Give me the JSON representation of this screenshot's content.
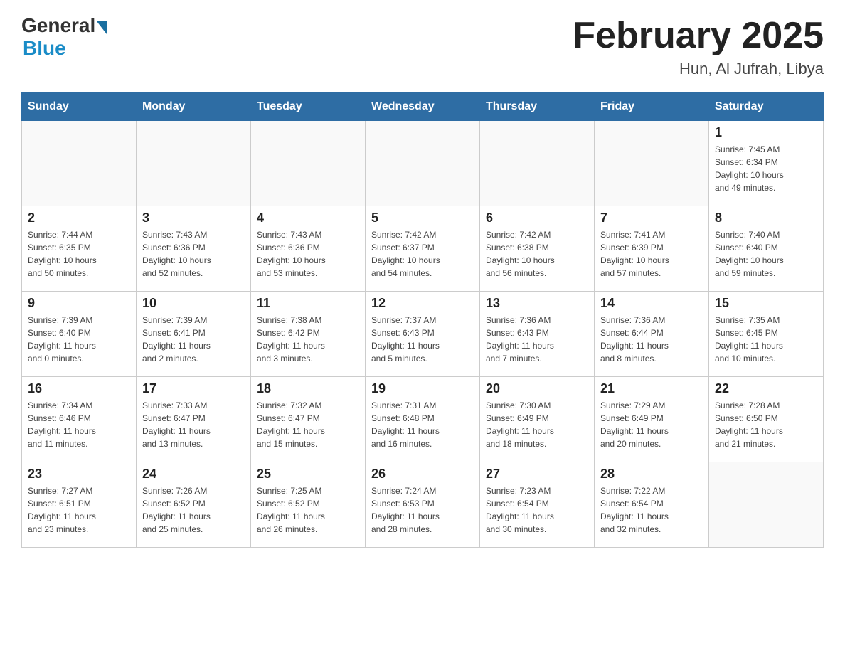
{
  "header": {
    "logo_general": "General",
    "logo_blue": "Blue",
    "title": "February 2025",
    "subtitle": "Hun, Al Jufrah, Libya"
  },
  "weekdays": [
    "Sunday",
    "Monday",
    "Tuesday",
    "Wednesday",
    "Thursday",
    "Friday",
    "Saturday"
  ],
  "weeks": [
    [
      {
        "day": "",
        "info": ""
      },
      {
        "day": "",
        "info": ""
      },
      {
        "day": "",
        "info": ""
      },
      {
        "day": "",
        "info": ""
      },
      {
        "day": "",
        "info": ""
      },
      {
        "day": "",
        "info": ""
      },
      {
        "day": "1",
        "info": "Sunrise: 7:45 AM\nSunset: 6:34 PM\nDaylight: 10 hours\nand 49 minutes."
      }
    ],
    [
      {
        "day": "2",
        "info": "Sunrise: 7:44 AM\nSunset: 6:35 PM\nDaylight: 10 hours\nand 50 minutes."
      },
      {
        "day": "3",
        "info": "Sunrise: 7:43 AM\nSunset: 6:36 PM\nDaylight: 10 hours\nand 52 minutes."
      },
      {
        "day": "4",
        "info": "Sunrise: 7:43 AM\nSunset: 6:36 PM\nDaylight: 10 hours\nand 53 minutes."
      },
      {
        "day": "5",
        "info": "Sunrise: 7:42 AM\nSunset: 6:37 PM\nDaylight: 10 hours\nand 54 minutes."
      },
      {
        "day": "6",
        "info": "Sunrise: 7:42 AM\nSunset: 6:38 PM\nDaylight: 10 hours\nand 56 minutes."
      },
      {
        "day": "7",
        "info": "Sunrise: 7:41 AM\nSunset: 6:39 PM\nDaylight: 10 hours\nand 57 minutes."
      },
      {
        "day": "8",
        "info": "Sunrise: 7:40 AM\nSunset: 6:40 PM\nDaylight: 10 hours\nand 59 minutes."
      }
    ],
    [
      {
        "day": "9",
        "info": "Sunrise: 7:39 AM\nSunset: 6:40 PM\nDaylight: 11 hours\nand 0 minutes."
      },
      {
        "day": "10",
        "info": "Sunrise: 7:39 AM\nSunset: 6:41 PM\nDaylight: 11 hours\nand 2 minutes."
      },
      {
        "day": "11",
        "info": "Sunrise: 7:38 AM\nSunset: 6:42 PM\nDaylight: 11 hours\nand 3 minutes."
      },
      {
        "day": "12",
        "info": "Sunrise: 7:37 AM\nSunset: 6:43 PM\nDaylight: 11 hours\nand 5 minutes."
      },
      {
        "day": "13",
        "info": "Sunrise: 7:36 AM\nSunset: 6:43 PM\nDaylight: 11 hours\nand 7 minutes."
      },
      {
        "day": "14",
        "info": "Sunrise: 7:36 AM\nSunset: 6:44 PM\nDaylight: 11 hours\nand 8 minutes."
      },
      {
        "day": "15",
        "info": "Sunrise: 7:35 AM\nSunset: 6:45 PM\nDaylight: 11 hours\nand 10 minutes."
      }
    ],
    [
      {
        "day": "16",
        "info": "Sunrise: 7:34 AM\nSunset: 6:46 PM\nDaylight: 11 hours\nand 11 minutes."
      },
      {
        "day": "17",
        "info": "Sunrise: 7:33 AM\nSunset: 6:47 PM\nDaylight: 11 hours\nand 13 minutes."
      },
      {
        "day": "18",
        "info": "Sunrise: 7:32 AM\nSunset: 6:47 PM\nDaylight: 11 hours\nand 15 minutes."
      },
      {
        "day": "19",
        "info": "Sunrise: 7:31 AM\nSunset: 6:48 PM\nDaylight: 11 hours\nand 16 minutes."
      },
      {
        "day": "20",
        "info": "Sunrise: 7:30 AM\nSunset: 6:49 PM\nDaylight: 11 hours\nand 18 minutes."
      },
      {
        "day": "21",
        "info": "Sunrise: 7:29 AM\nSunset: 6:49 PM\nDaylight: 11 hours\nand 20 minutes."
      },
      {
        "day": "22",
        "info": "Sunrise: 7:28 AM\nSunset: 6:50 PM\nDaylight: 11 hours\nand 21 minutes."
      }
    ],
    [
      {
        "day": "23",
        "info": "Sunrise: 7:27 AM\nSunset: 6:51 PM\nDaylight: 11 hours\nand 23 minutes."
      },
      {
        "day": "24",
        "info": "Sunrise: 7:26 AM\nSunset: 6:52 PM\nDaylight: 11 hours\nand 25 minutes."
      },
      {
        "day": "25",
        "info": "Sunrise: 7:25 AM\nSunset: 6:52 PM\nDaylight: 11 hours\nand 26 minutes."
      },
      {
        "day": "26",
        "info": "Sunrise: 7:24 AM\nSunset: 6:53 PM\nDaylight: 11 hours\nand 28 minutes."
      },
      {
        "day": "27",
        "info": "Sunrise: 7:23 AM\nSunset: 6:54 PM\nDaylight: 11 hours\nand 30 minutes."
      },
      {
        "day": "28",
        "info": "Sunrise: 7:22 AM\nSunset: 6:54 PM\nDaylight: 11 hours\nand 32 minutes."
      },
      {
        "day": "",
        "info": ""
      }
    ]
  ]
}
